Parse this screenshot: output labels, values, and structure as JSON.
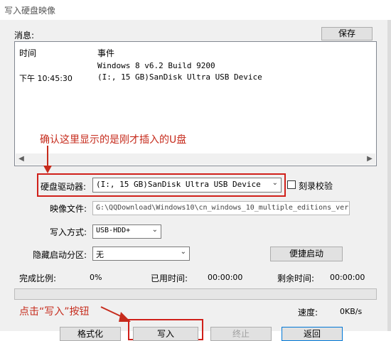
{
  "window": {
    "title": "写入硬盘映像"
  },
  "message": {
    "label": "消息:",
    "save_button": "保存",
    "columns": {
      "time": "时间",
      "event": "事件"
    },
    "rows": [
      {
        "time": "",
        "event": "Windows 8 v6.2 Build 9200"
      },
      {
        "time": "下午 10:45:30",
        "event": "(I:, 15 GB)SanDisk Ultra USB Device"
      }
    ]
  },
  "annotations": {
    "top": "确认这里显示的是刚才插入的U盘",
    "bottom": "点击“写入”按钮",
    "color": "#c62b1c"
  },
  "form": {
    "drive_label": "硬盘驱动器:",
    "drive_value": "(I:, 15 GB)SanDisk Ultra USB Device",
    "verify_label": "刻录校验",
    "image_label": "映像文件:",
    "image_value": "G:\\QQDownload\\Windows10\\cn_windows_10_multiple_editions_ver",
    "write_mode_label": "写入方式:",
    "write_mode_value": "USB-HDD+",
    "hidden_label": "隐藏启动分区:",
    "hidden_value": "无",
    "quick_boot_button": "便捷启动"
  },
  "status": {
    "ratio_label": "完成比例:",
    "ratio_value": "0%",
    "elapsed_label": "已用时间:",
    "elapsed_value": "00:00:00",
    "remaining_label": "剩余时间:",
    "remaining_value": "00:00:00",
    "speed_label": "速度:",
    "speed_value": "0KB/s",
    "progress": 0
  },
  "buttons": {
    "format": "格式化",
    "write": "写入",
    "terminate": "终止",
    "back": "返回"
  }
}
